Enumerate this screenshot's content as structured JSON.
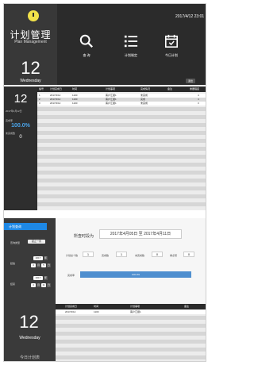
{
  "app": {
    "title": "计划管理",
    "subtitle": "Plan Management",
    "datetime": "2017/4/12 23:01"
  },
  "today": {
    "day": "12",
    "weekday": "Wednesday"
  },
  "nav": [
    {
      "label": "查 询",
      "icon": "search-icon"
    },
    {
      "label": "计划制定",
      "icon": "list-icon"
    },
    {
      "label": "今日计划",
      "icon": "calendar-icon"
    }
  ],
  "exit_label": "退出",
  "screen1": {
    "sidebar": {
      "day": "12",
      "date_line": "2017年4月12日",
      "rate_label": "完成率",
      "rate": "100.0%",
      "count_label": "未完成数",
      "count": "0"
    },
    "columns": [
      "编号",
      "计划完成日",
      "时间",
      "计划事项",
      "完成情况",
      "备注",
      "重要程度"
    ],
    "rows": [
      [
        "1",
        "2017/4/12",
        "1100",
        "客户汇报1",
        "未完成",
        "",
        "4"
      ],
      [
        "2",
        "2017/4/12",
        "1100",
        "客户汇报1",
        "完成",
        "",
        "4"
      ],
      [
        "3",
        "2017/4/12",
        "1100",
        "客户汇报1",
        "未完成",
        "",
        "3"
      ]
    ]
  },
  "screen2": {
    "tab": "计划查询",
    "range_type_label": "查询类型",
    "range_type_value": "起止一周",
    "start_label": "起始",
    "end_label": "结束",
    "start": {
      "year": "2017",
      "month": "4",
      "day": "5"
    },
    "end": {
      "year": "2017",
      "month": "4",
      "day": "11"
    },
    "ym_labels": {
      "year": "年",
      "month": "月",
      "day": "日"
    },
    "range_label": "所查时段为",
    "range_value": "2017年4月05日 至 2017年4月11日",
    "stats": [
      {
        "label": "计划总个数",
        "value": "1"
      },
      {
        "label": "完成数",
        "value": "1"
      },
      {
        "label": "未完成数",
        "value": "0"
      },
      {
        "label": "重点项",
        "value": "0"
      }
    ],
    "progress_label": "完成率",
    "progress_text": "100.0%",
    "progress": 1.0,
    "big_day": "12",
    "big_weekday": "Wednesday",
    "footer_link": "今日计划表",
    "columns": [
      "计划完成日",
      "时间",
      "计划事项",
      "备注"
    ],
    "rows": [
      [
        "2017/4/12",
        "1100",
        "客户汇报1",
        ""
      ]
    ]
  },
  "colors": {
    "accent": "#1e88e5",
    "dark": "#2b2b2b",
    "highlight": "#4aa3e8",
    "logo": "#f2e24a"
  }
}
